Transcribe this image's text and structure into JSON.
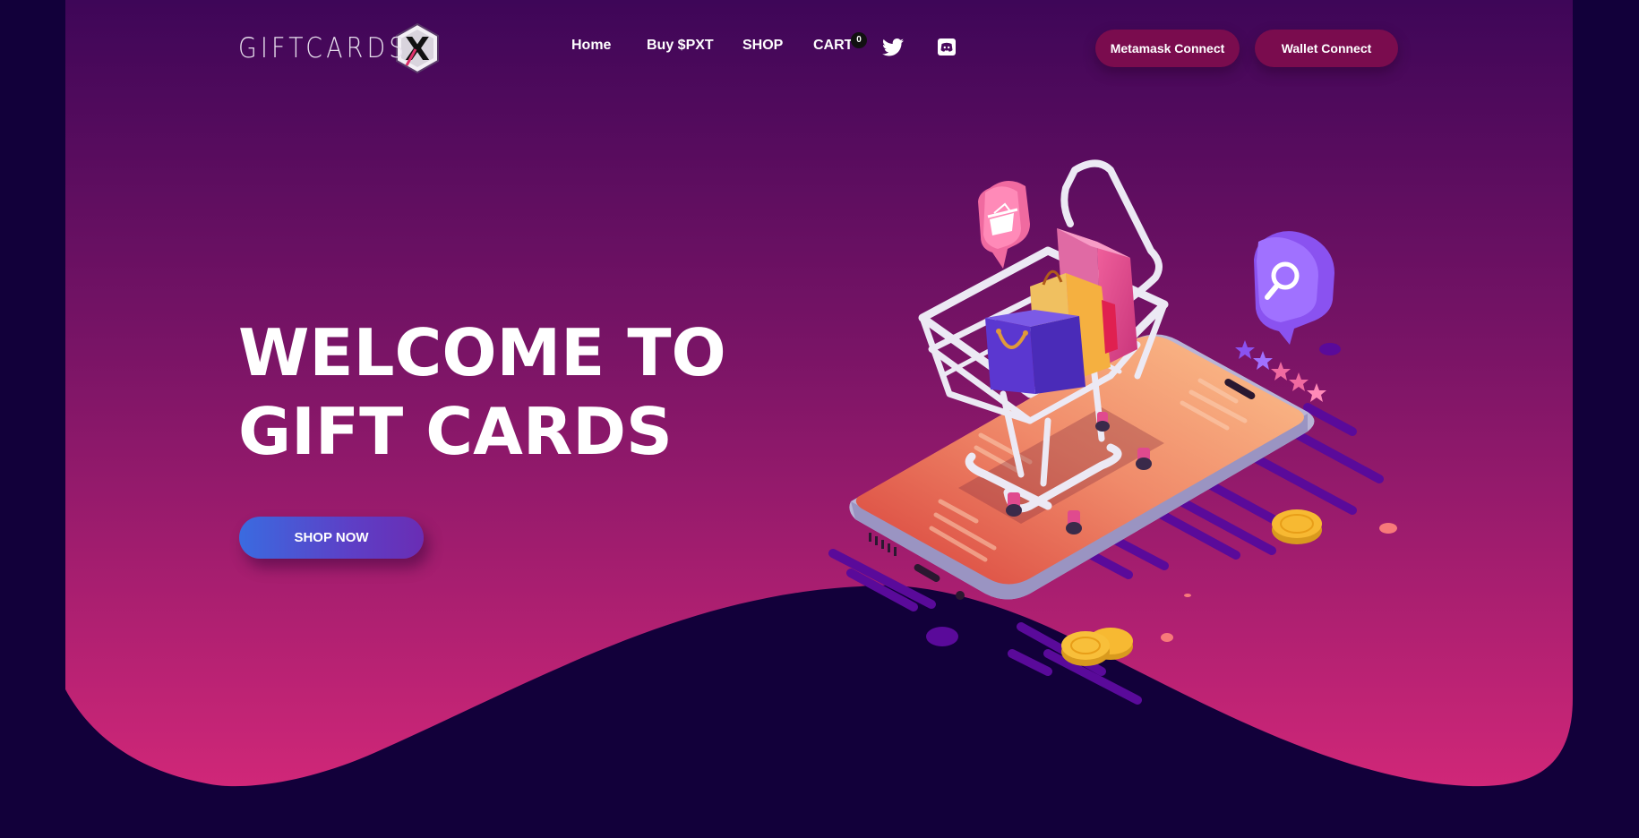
{
  "brand": {
    "name": "GIFTCARDS",
    "mark": "X"
  },
  "nav": {
    "home": "Home",
    "buy": "Buy $PXT",
    "shop": "SHOP",
    "cart": "CART",
    "cart_count": "0"
  },
  "social": {
    "twitter": "twitter-icon",
    "discord": "discord-icon"
  },
  "buttons": {
    "metamask": "Metamask Connect",
    "wallet": "Wallet Connect"
  },
  "hero": {
    "line1": "WELCOME TO",
    "line2": "GIFT CARDS",
    "cta": "SHOP NOW"
  },
  "colors": {
    "page_background": "#12003a",
    "hero_top": "#3e0658",
    "hero_bottom": "#d02778",
    "pill_button": "#7a0c4e",
    "cta_start": "#3a6be0",
    "cta_end": "#6a2db4"
  }
}
